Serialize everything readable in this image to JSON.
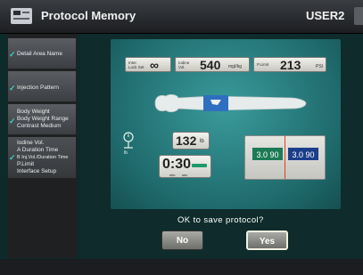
{
  "header": {
    "title": "Protocol Memory",
    "user": "USER2"
  },
  "sidebar": {
    "items": [
      {
        "lines": [
          "Detail Area Name"
        ],
        "checked": true
      },
      {
        "lines": [
          "Injection Pattern"
        ],
        "checked": true
      },
      {
        "lines": [
          "Body Weight",
          "Body Weight Range",
          "Contrast Medium"
        ],
        "checked": true
      },
      {
        "lines": [
          "Iodine Vol.",
          "A Duration Time",
          "B Inj.Vol./Duration Time",
          "P.Limit",
          "Interface Setup"
        ],
        "checked": true
      }
    ]
  },
  "stage": {
    "interlock": {
      "label1": "Inter",
      "label2": "Lock Set",
      "value": "∞"
    },
    "iodine": {
      "label1": "Iodine",
      "label2": "Vol.",
      "value": "540",
      "unit": "mgI/kg"
    },
    "plimit": {
      "label": "P.Limit",
      "value": "213",
      "unit": "PSI"
    },
    "weight": {
      "value": "132",
      "unit": "lb",
      "scale_unit": "lb"
    },
    "duration": {
      "value": "0:30",
      "min": "min",
      "sec": "sec"
    },
    "ratio": {
      "a": "3.0 90",
      "b": "3.0 90"
    }
  },
  "confirm": {
    "prompt": "OK to save protocol?",
    "no": "No",
    "yes": "Yes"
  },
  "colors": {
    "accent": "#27b8b0",
    "phase_a": "#1e7a55",
    "phase_b": "#1c3f8a"
  }
}
